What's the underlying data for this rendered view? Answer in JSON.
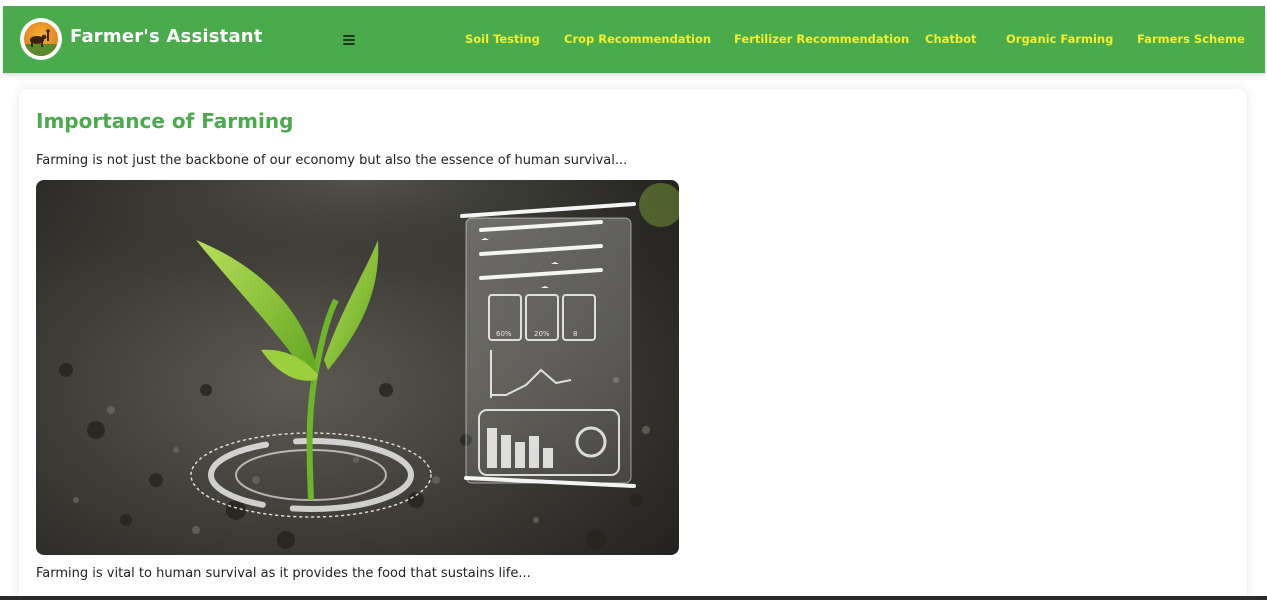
{
  "app": {
    "brand": "Farmer's Assistant"
  },
  "nav": {
    "links": [
      {
        "label": "Soil Testing"
      },
      {
        "label": "Crop Recommendation"
      },
      {
        "label": "Fertilizer Recommendation"
      },
      {
        "label": "Chatbot"
      },
      {
        "label": "Organic Farming"
      },
      {
        "label": "Farmers Scheme"
      }
    ]
  },
  "main": {
    "title": "Importance of Farming",
    "intro": "Farming is not just the backbone of our economy but also the essence of human survival...",
    "closing": "Farming is vital to human survival as it provides the food that sustains life..."
  },
  "hero_image": {
    "readouts": [
      "60%",
      "20%",
      "8"
    ]
  },
  "colors": {
    "nav_bg": "#4aab4c",
    "nav_link": "#f2ef2e",
    "title": "#4aab4c"
  }
}
